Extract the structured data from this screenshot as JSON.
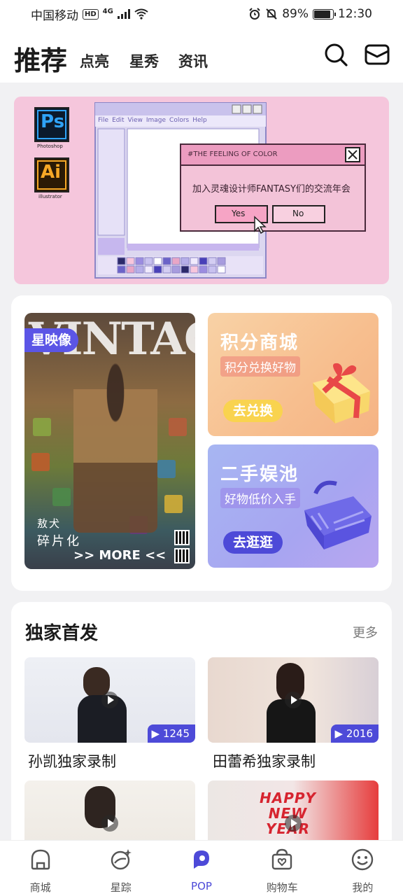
{
  "status_bar": {
    "carrier": "中国移动",
    "hd": "HD",
    "network": "4G",
    "battery_percent": "89%",
    "battery_level": 0.89,
    "time": "12:30"
  },
  "header": {
    "title": "推荐",
    "tabs": [
      "点亮",
      "星秀",
      "资讯"
    ]
  },
  "banner": {
    "ps_label": "Ps",
    "ps_caption": "Photoshop",
    "ai_label": "Ai",
    "ai_caption": "illustrator",
    "menu": [
      "File",
      "Edit",
      "View",
      "Image",
      "Colors",
      "Help"
    ],
    "dialog_title": "#THE FEELING OF COLOR",
    "dialog_text": "加入灵魂设计师FANTASY们的交流年会",
    "yes_label": "Yes",
    "no_label": "No"
  },
  "poster": {
    "magazine": "VINTAGE",
    "badge": "星映像",
    "caption1": "敖犬",
    "caption2": "碎片化",
    "more": ">> MORE <<"
  },
  "points_card": {
    "title": "积分商城",
    "subtitle": "积分兑换好物",
    "button": "去兑换"
  },
  "secondhand_card": {
    "title": "二手娱池",
    "subtitle": "好物低价入手",
    "button": "去逛逛"
  },
  "exclusive": {
    "title": "独家首发",
    "more": "更多",
    "videos": [
      {
        "caption": "孙凯独家录制",
        "count": "1245"
      },
      {
        "caption": "田蕾希独家录制",
        "count": "2016"
      },
      {
        "caption": "",
        "count": ""
      },
      {
        "caption": "",
        "count": ""
      }
    ],
    "happy_text": [
      "HAPPY",
      "NEW",
      "YEAR"
    ]
  },
  "bottom_nav": [
    {
      "label": "商城",
      "icon": "shop-icon",
      "active": false
    },
    {
      "label": "星踪",
      "icon": "planet-icon",
      "active": false
    },
    {
      "label": "POP",
      "icon": "pop-icon",
      "active": true
    },
    {
      "label": "购物车",
      "icon": "cart-icon",
      "active": false
    },
    {
      "label": "我的",
      "icon": "smile-icon",
      "active": false
    }
  ],
  "colors": {
    "accent": "#4d4ad8",
    "banner_bg": "#f5c6dc",
    "points_bg": "#f6c48e",
    "secondhand_bg": "#a9a8f2"
  }
}
